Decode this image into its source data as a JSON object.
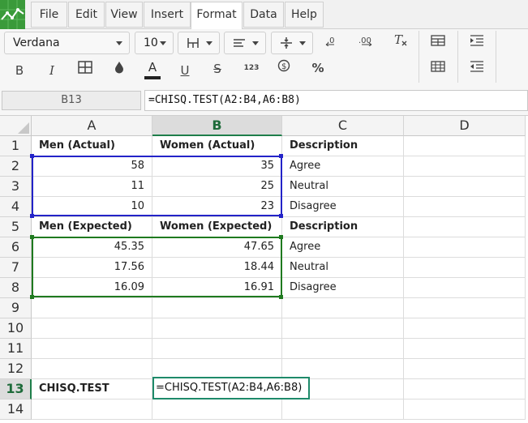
{
  "menu": {
    "items": [
      "File",
      "Edit",
      "View",
      "Insert",
      "Format",
      "Data",
      "Help"
    ],
    "active": "Format"
  },
  "toolbar": {
    "font_family": "Verdana",
    "font_size": "10",
    "number_format_label": "123"
  },
  "formula_bar": {
    "name_box": "B13",
    "formula": "=CHISQ.TEST(A2:B4,A6:B8)"
  },
  "grid": {
    "columns": [
      "A",
      "B",
      "C",
      "D"
    ],
    "selected_column": "B",
    "rows": [
      "1",
      "2",
      "3",
      "4",
      "5",
      "6",
      "7",
      "8",
      "9",
      "10",
      "11",
      "12",
      "13",
      "14"
    ],
    "selected_row": "13",
    "cells": {
      "A1": "Men (Actual)",
      "B1": "Women (Actual)",
      "C1": "Description",
      "A2": "58",
      "B2": "35",
      "C2": "Agree",
      "A3": "11",
      "B3": "25",
      "C3": "Neutral",
      "A4": "10",
      "B4": "23",
      "C4": "Disagree",
      "A5": "Men (Expected)",
      "B5": "Women (Expected)",
      "C5": "Description",
      "A6": "45.35",
      "B6": "47.65",
      "C6": "Agree",
      "A7": "17.56",
      "B7": "18.44",
      "C7": "Neutral",
      "A8": "16.09",
      "B8": "16.91",
      "C8": "Disagree",
      "A13": "CHISQ.TEST"
    },
    "editor_text": "=CHISQ.TEST(A2:B4,A6:B8)"
  },
  "colors": {
    "accent": "#1e7e4a",
    "range_actual": "#2323c8",
    "range_expected": "#1f7a1f",
    "logo": "#3a9a3a"
  }
}
